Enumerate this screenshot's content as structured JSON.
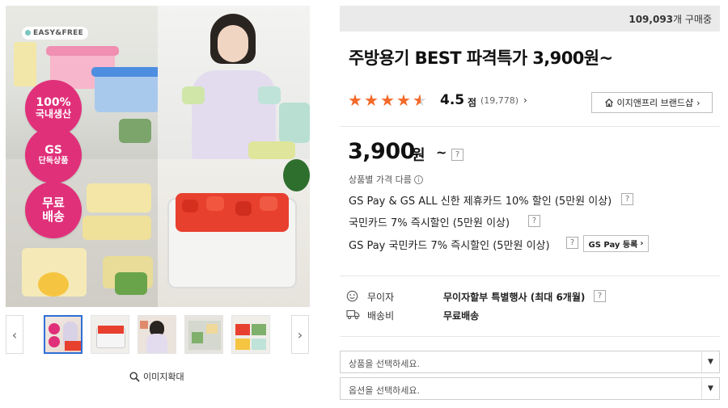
{
  "gallery": {
    "brand_badge": "EASY&FREE",
    "badges": [
      {
        "line1": "100%",
        "line2": "국내생산"
      },
      {
        "line1": "GS",
        "line2": "단독상품"
      },
      {
        "line1": "무료",
        "line2": "배송"
      }
    ],
    "prev_icon": "chevron-left-icon",
    "next_icon": "chevron-right-icon",
    "thumbnail_count": 5,
    "selected_thumbnail": 1,
    "zoom_label": "이미지확대"
  },
  "header": {
    "sold_count": "109,093",
    "sold_suffix": "개 구매중"
  },
  "product": {
    "title": "주방용기 BEST 파격특가 3,900원~",
    "rating": {
      "score": "4.5",
      "unit": "점",
      "count": "(19,778)",
      "stars_value": 4.5,
      "stars_max": 5
    },
    "brand_shop_label": "이지앤프리 브랜드샵",
    "price": "3,900",
    "price_unit": "원",
    "price_tilde": "~",
    "price_diff_label": "상품별 가격 다름",
    "discounts": [
      "GS Pay & GS ALL 신한 제휴카드 10% 할인 (5만원 이상)",
      "국민카드 7% 즉시할인 (5만원 이상)",
      "GS Pay 국민카드 7% 즉시할인 (5만원 이상)"
    ],
    "gspay_register_label": "GS Pay 등록",
    "installment": {
      "label": "무이자",
      "value": "무이자할부 특별행사 (최대 6개월)"
    },
    "shipping": {
      "label": "배송비",
      "value": "무료배송"
    },
    "select_product_placeholder": "상품을 선택하세요.",
    "select_option_placeholder": "옵션을 선택하세요."
  },
  "colors": {
    "accent_star": "#f26a2a",
    "badge_pink": "#e0307a",
    "thumb_selected": "#2e6fd8"
  }
}
